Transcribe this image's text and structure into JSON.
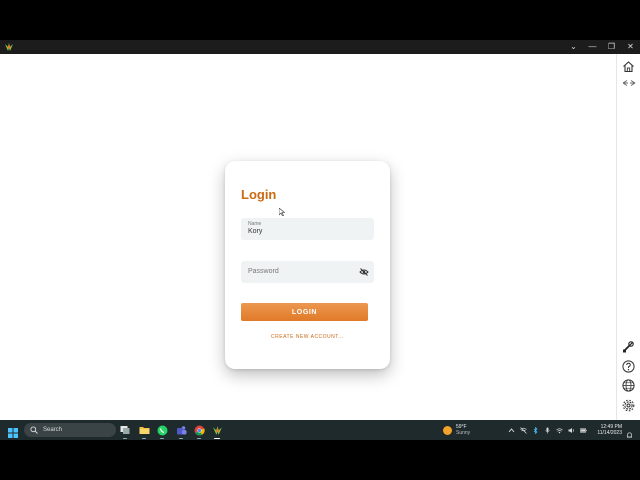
{
  "window": {
    "controls": {
      "dropdown": "⌄",
      "minimize": "—",
      "restore": "❐",
      "close": "✕"
    }
  },
  "login": {
    "title": "Login",
    "name_label": "Name",
    "name_value": "Kory",
    "password_placeholder": "Password",
    "login_button": "LOGIN",
    "create_account_link": "CREATE NEW ACCOUNT..."
  },
  "rail": {
    "icons": [
      "home-icon",
      "back-forward-icon",
      "tools-icon",
      "help-icon",
      "globe-icon",
      "gear-icon"
    ]
  },
  "taskbar": {
    "search_label": "Search",
    "apps": [
      "task-view-icon",
      "file-explorer-icon",
      "whatsapp-icon",
      "teams-icon",
      "chrome-icon",
      "app-logo-icon"
    ],
    "weather": {
      "temp": "59°F",
      "condition": "Sunny"
    },
    "clock": {
      "time": "12:49 PM",
      "date": "11/14/2023"
    }
  },
  "colors": {
    "accent": "#c96a14",
    "button_top": "#ec9850",
    "button_bottom": "#e07a28",
    "field_bg": "#f0f3f4",
    "taskbar_bg": "#1f2a2d"
  }
}
